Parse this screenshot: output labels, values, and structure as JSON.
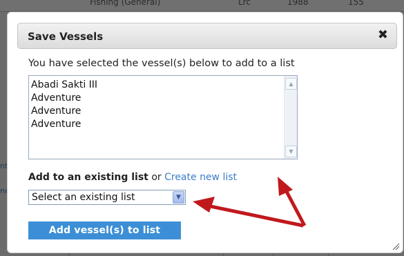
{
  "background": {
    "row_cells": [
      "Fishing (General)",
      "Lrc",
      "1988",
      "155"
    ],
    "edge_links": [
      "nt",
      "ne"
    ]
  },
  "dialog": {
    "title": "Save Vessels",
    "close_icon": "close-icon",
    "intro": "You have selected the vessel(s) below to add to a list",
    "vessels": [
      "Abadi Sakti III",
      "Adventure",
      "Adventure",
      "Adventure"
    ],
    "add_existing_label": "Add to an existing list",
    "or_text": "or",
    "create_link": "Create new list",
    "select": {
      "selected": "Select an existing list",
      "options": [
        "Select an existing list"
      ]
    },
    "add_button": "Add vessel(s) to list"
  },
  "colors": {
    "accent": "#3c8fd6",
    "link": "#3d7cc9",
    "annotation_arrow": "#c0191d"
  }
}
